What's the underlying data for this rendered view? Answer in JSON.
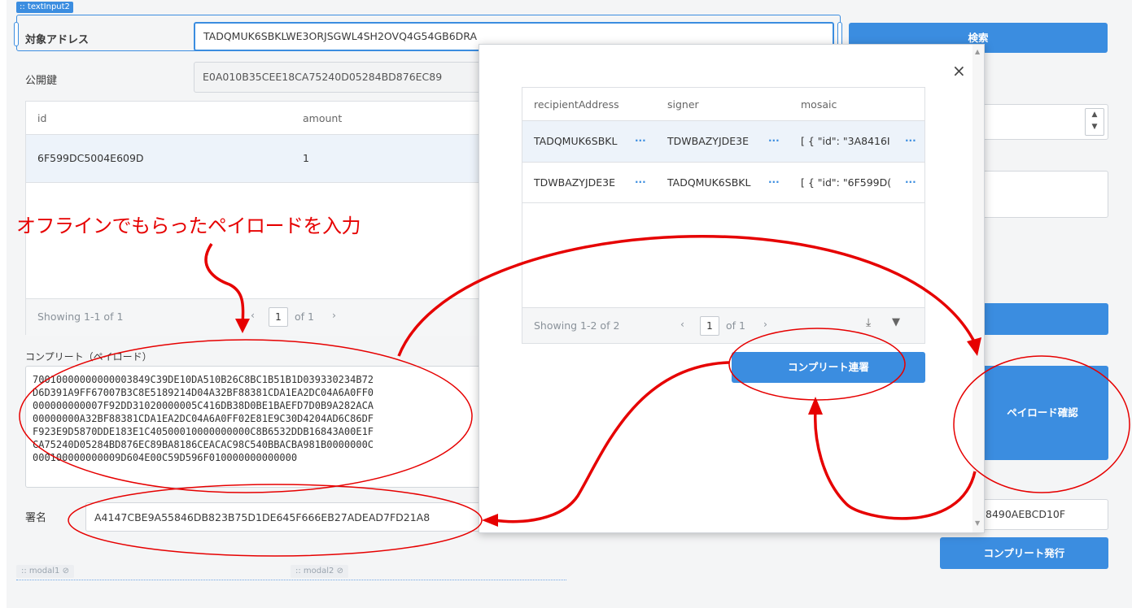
{
  "editor": {
    "text_input_tag": ":: textInput2",
    "modal1_tag": ":: modal1 ⊘",
    "modal2_tag": ":: modal2 ⊘"
  },
  "form": {
    "address_label": "対象アドレス",
    "address_value": "TADQMUK6SBKLWE3ORJSGWL4SH2OVQ4G54GB6DRA",
    "search_button": "検索",
    "pubkey_label": "公開鍵",
    "pubkey_value": "E0A010B35CEE18CA75240D05284BD876EC89",
    "mosaic_table": {
      "columns": [
        "id",
        "amount"
      ],
      "rows": [
        {
          "id": "6F599DC5004E609D",
          "amount": "1"
        }
      ],
      "footer": "Showing 1-1 of 1",
      "page": "1",
      "of": "of 1"
    },
    "payload_label": "コンプリート（ペイロード）",
    "payload_lines": [
      "70010000000000003849C39DE10DA510B26C8BC1B51B1D039330234B72",
      "D6D391A9FF67007B3C8E5189214D04A32BF88381CDA1EA2DC04A6A0FF0",
      "000000000007F92DD31020000005C416DB38D0BE1BAEFD7D0B9A282ACA",
      "00000000A32BF88381CDA1EA2DC04A6A0FF02E81E9C30D4204AD6C86DF",
      "F923E9D5870DDE183E1C40500010000000000C8B6532DDB16843A00E1F",
      "CA75240D05284BD876EC89BA8186CEACAC98C540BBACBA981B0000000C",
      "000100000000009D604E00C59D596F010000000000000"
    ],
    "signature_label": "署名",
    "signature_value": "A4147CBE9A55846DB823B75D1DE645F666EB27ADEAD7FD21A8",
    "signature_tail": "8490AEBCD10F",
    "payload_check_button": "ペイロード確認",
    "issue_button": "コンプリート発行"
  },
  "modal": {
    "close_icon": "×",
    "columns": [
      "recipientAddress",
      "signer",
      "mosaic"
    ],
    "rows": [
      {
        "recipientAddress": "TADQMUK6SBKL",
        "signer": "TDWBAZYJDE3E",
        "mosaic": "[ { \"id\": \"3A8416I"
      },
      {
        "recipientAddress": "TDWBAZYJDE3E",
        "signer": "TADQMUK6SBKL",
        "mosaic": "[ { \"id\": \"6F599D("
      }
    ],
    "more": "···",
    "footer": "Showing 1-2 of 2",
    "page": "1",
    "of": "of 1",
    "cosign_button": "コンプリート連署"
  },
  "annotation": {
    "text": "オフラインでもらったペイロードを入力"
  },
  "colors": {
    "accent": "#3b8de0",
    "annotation": "#e60000"
  }
}
